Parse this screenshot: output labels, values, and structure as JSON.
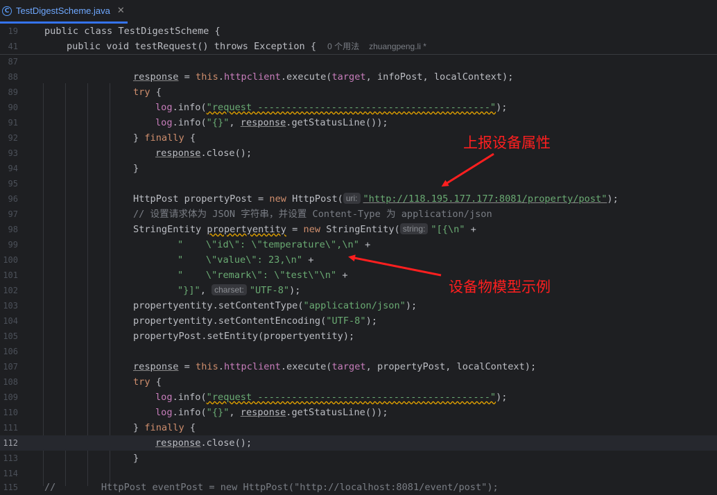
{
  "tab": {
    "title": "TestDigestScheme.java",
    "icon_letter": "C",
    "close_glyph": "✕"
  },
  "sticky": [
    {
      "num": "19",
      "code": "public class TestDigestScheme {"
    },
    {
      "num": "41",
      "code": "public void testRequest() throws Exception {",
      "usages": "0 个用法",
      "author": "zhuangpeng.li *"
    }
  ],
  "annotations": {
    "report": "上报设备属性",
    "model": "设备物模型示例"
  },
  "hints": {
    "uri": "uri:",
    "string": "string:",
    "charset": "charset:"
  },
  "lines": {
    "l87": "87",
    "l88": "88",
    "l89": "89",
    "l90": "90",
    "l91": "91",
    "l92": "92",
    "l93": "93",
    "l94": "94",
    "l95": "95",
    "l96": "96",
    "l97": "97",
    "l98": "98",
    "l99": "99",
    "l100": "100",
    "l101": "101",
    "l102": "102",
    "l103": "103",
    "l104": "104",
    "l105": "105",
    "l106": "106",
    "l107": "107",
    "l108": "108",
    "l109": "109",
    "l110": "110",
    "l111": "111",
    "l112": "112",
    "l113": "113",
    "l114": "114",
    "l115": "115"
  },
  "code": {
    "response": "response",
    "this": "this",
    "httpclient": "httpclient",
    "try": "try",
    "finally": "finally",
    "log": "log",
    "info_open": ".info(",
    "request_str": "\"request -----------------------------------------\"",
    "braces_str": "\"{}\"",
    "status": ".getStatusLine());",
    "close": ".close();",
    "new": "new",
    "url": "\"http://118.195.177.177:8081/property/post\"",
    "comment97": "// 设置请求体为 JSON 字符串，并设置 Content-Type 为 application/json",
    "propertyentity": "propertyentity",
    "l98_str": "\"[{\\n\"",
    "l99_str": "\"    \\\"id\\\": \\\"temperature\\\",\\n\"",
    "l100_str": "\"    \\\"value\\\": 23,\\n\"",
    "l101_str": "\"    \\\"remark\\\": \\\"test\\\"\\n\"",
    "l102_str": "\"}]\"",
    "utf8": "\"UTF-8\"",
    "appjson": "\"application/json\"",
    "l115_code": "//        HttpPost eventPost = new HttpPost(\"http://localhost:8081/event/post\");"
  }
}
